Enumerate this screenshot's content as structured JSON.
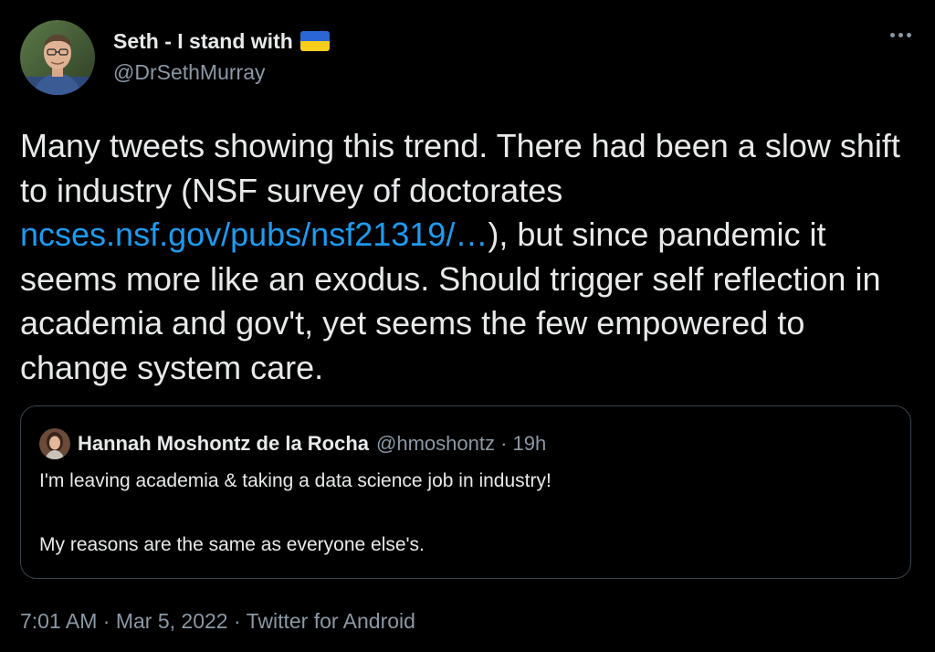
{
  "author": {
    "display_name": "Seth - I stand with",
    "flag_icon": "ukraine-flag-icon",
    "handle": "@DrSethMurray",
    "more_icon": "more-options-icon"
  },
  "tweet": {
    "text_before_link": "Many tweets showing this trend. There had been a slow shift to industry (NSF survey of doctorates ",
    "link_text": "ncses.nsf.gov/pubs/nsf21319/…",
    "text_after_link": "), but since pandemic it seems more like an exodus. Should trigger self reflection in academia and gov't, yet seems the few empowered to change system care."
  },
  "quote": {
    "name": "Hannah Moshontz de la Rocha",
    "handle_time": "@hmoshontz · 19h",
    "line1": "I'm leaving academia & taking a data science job in industry!",
    "line2": "My reasons are the same as everyone else's."
  },
  "meta": {
    "timestamp_source": "7:01 AM · Mar 5, 2022 · Twitter for Android"
  },
  "colors": {
    "background": "#000000",
    "text": "#e7e9ea",
    "secondary": "#8b98a5",
    "link": "#1d9bf0",
    "border": "#38444d"
  }
}
